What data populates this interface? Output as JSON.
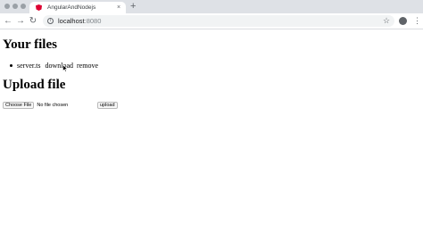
{
  "browser": {
    "tab": {
      "title": "AngularAndNodejs",
      "close_glyph": "×"
    },
    "new_tab_glyph": "+",
    "nav": {
      "back_glyph": "←",
      "forward_glyph": "→",
      "reload_glyph": "↻"
    },
    "address": {
      "host": "localhost",
      "port": ":8080"
    },
    "star_glyph": "☆",
    "menu_glyph": "⋮"
  },
  "page": {
    "files_heading": "Your files",
    "files": [
      {
        "name": "server.ts",
        "download_label": "download",
        "remove_label": "remove"
      }
    ],
    "upload_heading": "Upload file",
    "choose_file_label": "Choose File",
    "no_file_text": "No file chosen",
    "upload_button_label": "upload"
  },
  "colors": {
    "tabstrip_bg": "#dee1e6",
    "omnibox_bg": "#f1f3f4",
    "angular_red": "#dd0031"
  }
}
